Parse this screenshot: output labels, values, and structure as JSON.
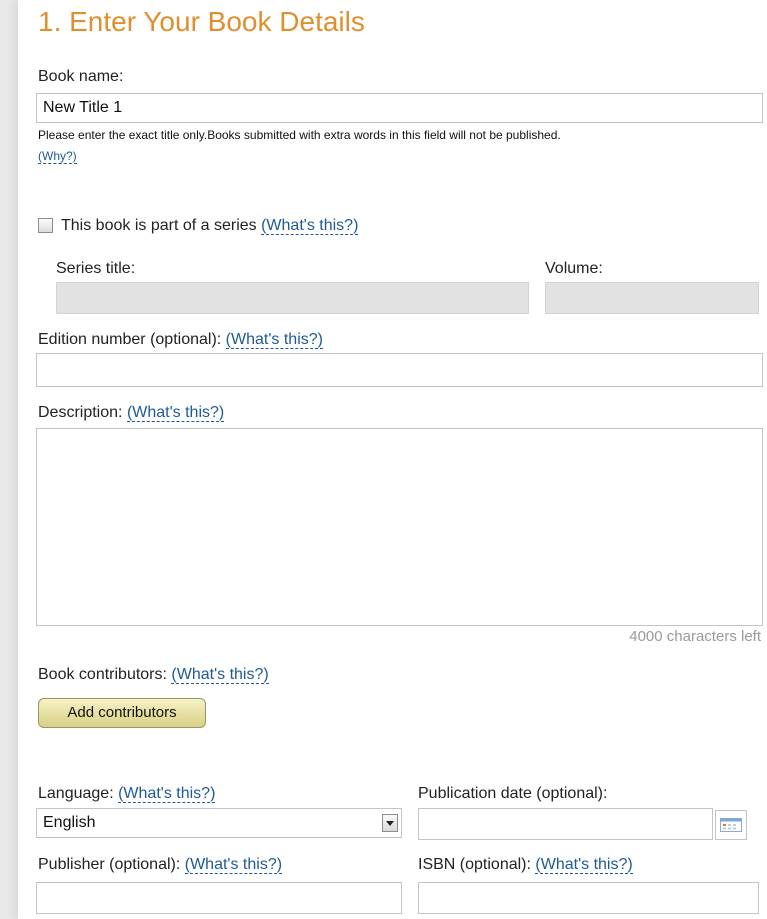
{
  "heading": "1. Enter Your Book Details",
  "book_name": {
    "label": "Book name:",
    "value": "New Title 1",
    "hint": "Please enter the exact title only.Books submitted with extra words in this field will not be published.",
    "why_link": "(Why?)"
  },
  "series": {
    "checkbox_label": "This book is part of a series",
    "whats_this": "(What's this?)",
    "checked": false,
    "title_label": "Series title:",
    "volume_label": "Volume:"
  },
  "edition": {
    "label": "Edition number (optional):",
    "whats_this": "(What's this?)",
    "value": ""
  },
  "description": {
    "label": "Description:",
    "whats_this": "(What's this?)",
    "value": "",
    "chars_left": "4000 characters left"
  },
  "contributors": {
    "label": "Book contributors:",
    "whats_this": "(What's this?)",
    "button_label": "Add contributors"
  },
  "language": {
    "label": "Language:",
    "whats_this": "(What's this?)",
    "selected": "English"
  },
  "publication_date": {
    "label": "Publication date (optional):",
    "value": ""
  },
  "publisher": {
    "label": "Publisher (optional):",
    "whats_this": "(What's this?)",
    "value": ""
  },
  "isbn": {
    "label": "ISBN (optional):",
    "whats_this": "(What's this?)",
    "value": ""
  },
  "colors": {
    "heading": "#e08f2e",
    "link": "#1f5a93",
    "button": "#e5df9f",
    "disabled_field": "#e2e2e2"
  },
  "icons": {
    "calendar": "calendar-icon",
    "dropdown": "chevron-down-icon"
  }
}
